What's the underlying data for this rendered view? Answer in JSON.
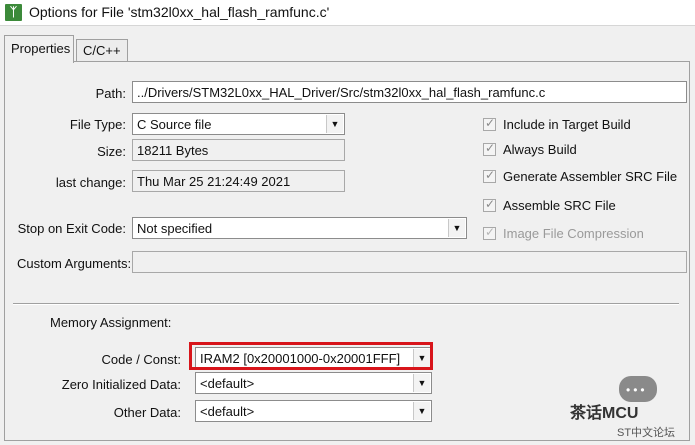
{
  "window": {
    "title": "Options for File 'stm32l0xx_hal_flash_ramfunc.c'",
    "icon": "keil-app-icon"
  },
  "tabs": [
    {
      "label": "Properties",
      "active": true
    },
    {
      "label": "C/C++",
      "active": false
    }
  ],
  "path": {
    "label": "Path:",
    "value": "../Drivers/STM32L0xx_HAL_Driver/Src/stm32l0xx_hal_flash_ramfunc.c"
  },
  "file_type": {
    "label": "File Type:",
    "value": "C Source file"
  },
  "size": {
    "label": "Size:",
    "value": "18211 Bytes"
  },
  "last_change": {
    "label": "last change:",
    "value": "Thu Mar 25 21:24:49 2021"
  },
  "stop_on_exit": {
    "label": "Stop on Exit Code:",
    "value": "Not specified"
  },
  "custom_args": {
    "label": "Custom Arguments:",
    "value": ""
  },
  "checkboxes": [
    {
      "label": "Include in Target Build",
      "checked": true,
      "disabled": false
    },
    {
      "label": "Always Build",
      "checked": true,
      "disabled": false
    },
    {
      "label": "Generate Assembler SRC File",
      "checked": true,
      "disabled": false
    },
    {
      "label": "Assemble SRC File",
      "checked": true,
      "disabled": false
    },
    {
      "label": "Image File Compression",
      "checked": true,
      "disabled": true
    }
  ],
  "memory": {
    "heading": "Memory Assignment:",
    "code_const": {
      "label": "Code / Const:",
      "value": "IRAM2 [0x20001000-0x20001FFF]"
    },
    "zero_init": {
      "label": "Zero Initialized Data:",
      "value": "<default>"
    },
    "other": {
      "label": "Other Data:",
      "value": "<default>"
    }
  },
  "watermark": {
    "main": "茶话MCU",
    "sub": "ST中文论坛"
  },
  "colors": {
    "highlight": "#d8151b",
    "dialog_bg": "#f0f0f0"
  }
}
